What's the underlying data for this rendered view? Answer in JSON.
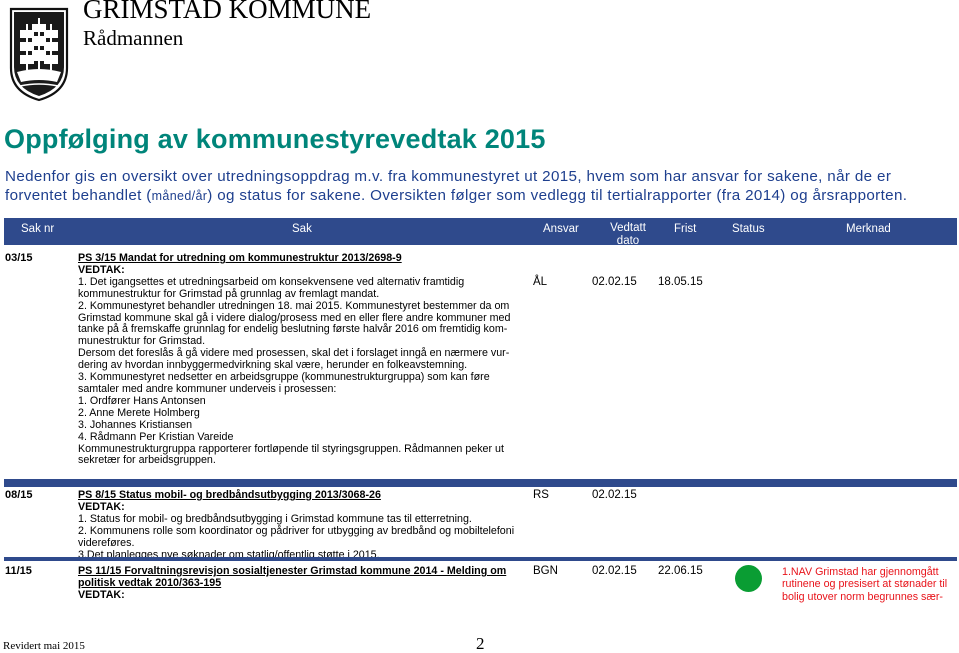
{
  "header": {
    "org_name": "GRIMSTAD KOMMUNE",
    "org_sub": "Rådmannen"
  },
  "title": "Oppfølging av kommunestyrevedtak 2015",
  "intro": {
    "part1": "Nedenfor gis en oversikt over utredningsoppdrag m.v. fra kommunestyret ut 2015, hvem som har ansvar for sakene, når de er forventet behandlet (",
    "small": "måned/år",
    "part2": ") og status for sakene. Oversikten følger som vedlegg til tertialrapporter (fra 2014) og årsrapporten."
  },
  "table": {
    "headers": {
      "saknr": "Sak nr",
      "sak": "Sak",
      "ansvar": "Ansvar",
      "vedtatt_1": "Vedtatt",
      "vedtatt_2": "dato",
      "frist": "Frist",
      "status": "Status",
      "merknad": "Merknad"
    },
    "rows": [
      {
        "saknr": "03/15",
        "title": "PS 3/15 Mandat for utredning om kommunestruktur 2013/2698-9",
        "vedtak_label": "VEDTAK:",
        "lines": [
          "1. Det igangsettes et utredningsarbeid om konsekvensene ved alternativ framtidig",
          "kommunestruktur for Grimstad på grunnlag av fremlagt mandat.",
          "2. Kommunestyret behandler utredningen 18. mai 2015. Kommunestyret bestemmer da om",
          "Grimstad kommune skal gå i videre dialog/prosess med en eller flere andre kommuner med",
          "tanke på å fremskaffe grunnlag for endelig beslutning første halvår 2016 om fremtidig kom-",
          "munestruktur for Grimstad.",
          "Dersom det foreslås å gå videre med prosessen, skal det i forslaget inngå en nærmere vur-",
          "dering av hvordan innbyggermedvirkning skal være, herunder en folkeavstemning.",
          "3. Kommunestyret nedsetter en arbeidsgruppe (kommunestrukturgruppa) som kan føre",
          "samtaler med andre kommuner underveis i prosessen:",
          "1. Ordfører Hans Antonsen",
          "2. Anne Merete Holmberg",
          "3. Johannes Kristiansen",
          "4. Rådmann Per Kristian Vareide",
          "Kommunestrukturgruppa rapporterer fortløpende til styringsgruppen. Rådmannen peker ut",
          "sekretær for arbeidsgruppen."
        ],
        "ansvar": "ÅL",
        "vedtatt": "02.02.15",
        "frist": "18.05.15",
        "merknad": []
      },
      {
        "saknr": "08/15",
        "title": "PS 8/15 Status mobil- og bredbåndsutbygging 2013/3068-26",
        "vedtak_label": "VEDTAK:",
        "lines": [
          "1. Status for mobil- og bredbåndsutbygging i Grimstad kommune tas til etterretning.",
          "2. Kommunens rolle som koordinator og pådriver for utbygging av bredbånd og mobiltelefoni",
          "videreføres.",
          "3.Det planlegges nye søknader om statlig/offentlig støtte i 2015."
        ],
        "ansvar": "RS",
        "vedtatt": "02.02.15",
        "frist": "",
        "merknad": []
      },
      {
        "saknr": "11/15",
        "title": "PS 11/15 Forvaltningsrevisjon sosialtjenester Grimstad kommune 2014 - Melding om",
        "title_2": "politisk vedtak 2010/363-195",
        "vedtak_label": "VEDTAK:",
        "lines": [],
        "ansvar": "BGN",
        "vedtatt": "02.02.15",
        "frist": "22.06.15",
        "status_color": "#0a9d33",
        "merknad": [
          "1.NAV Grimstad har gjennomgått",
          "rutinene og presisert at stønader til",
          "bolig utover norm begrunnes sær-"
        ]
      }
    ]
  },
  "footer": {
    "revised": "Revidert mai 2015",
    "page": "2"
  },
  "colors": {
    "title": "#00857a",
    "intro": "#1e3f8e",
    "header_bar": "#2f4a8c",
    "merknad": "#e8131a"
  }
}
